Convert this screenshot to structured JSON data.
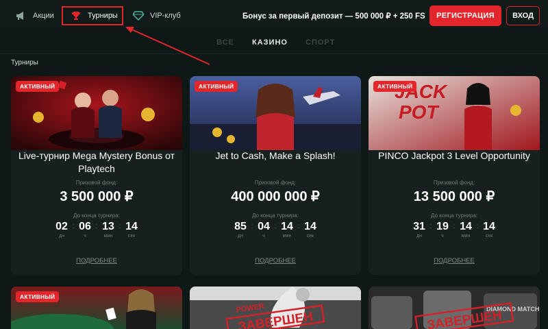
{
  "header": {
    "nav": [
      {
        "label": "Акции",
        "icon": "megaphone-icon"
      },
      {
        "label": "Турниры",
        "icon": "trophy-icon"
      },
      {
        "label": "VIP-клуб",
        "icon": "diamond-icon"
      }
    ],
    "bonus_text": "Бонус за первый депозит — 500 000 ₽ + 250 FS",
    "register_label": "РЕГИСТРАЦИЯ",
    "login_label": "ВХОД"
  },
  "tabs": [
    {
      "label": "ВСЕ",
      "active": false
    },
    {
      "label": "КАЗИНО",
      "active": true
    },
    {
      "label": "СПОРТ",
      "active": false
    }
  ],
  "section_title": "Турниры",
  "labels": {
    "fund": "Призовой фонд:",
    "ends": "До конца турнира:",
    "more": "ПОДРОБНЕЕ",
    "units": [
      "дн",
      "ч",
      "мин",
      "сек"
    ]
  },
  "cards": [
    {
      "badge": "АКТИВНЫЙ",
      "title": "Live-турнир Mega Mystery Bonus от Playtech",
      "prize": "3 500 000 ₽",
      "timer": [
        "02",
        "06",
        "13",
        "14"
      ]
    },
    {
      "badge": "АКТИВНЫЙ",
      "title": "Jet to Cash, Make a Splash!",
      "prize": "400 000 000 ₽",
      "timer": [
        "85",
        "04",
        "14",
        "14"
      ]
    },
    {
      "badge": "АКТИВНЫЙ",
      "title": "PINCO Jackpot 3 Level Opportunity",
      "prize": "13 500 000 ₽",
      "timer": [
        "31",
        "19",
        "14",
        "14"
      ],
      "image_text": "JACK POT"
    }
  ],
  "bottom_cards": [
    {
      "badge": "АКТИВНЫЙ"
    },
    {
      "stamp": "ЗАВЕРШЕН",
      "image_text": "POWER"
    },
    {
      "stamp": "ЗАВЕРШЕН",
      "image_text": "DIAMOND MATCH"
    }
  ],
  "colors": {
    "accent": "#e3262b",
    "background": "#0e1817",
    "card": "#16211f"
  }
}
